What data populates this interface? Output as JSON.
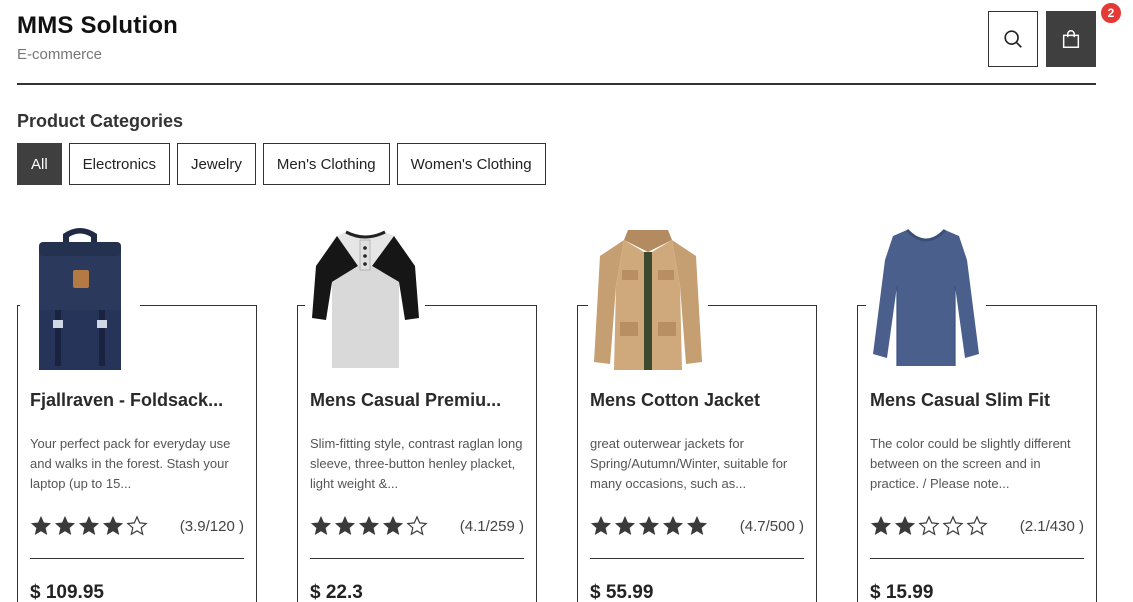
{
  "header": {
    "title": "MMS Solution",
    "subtitle": "E-commerce",
    "cart_count": "2"
  },
  "categories": {
    "heading": "Product Categories",
    "items": [
      "All",
      "Electronics",
      "Jewelry",
      "Men's Clothing",
      "Women's Clothing"
    ],
    "active": "All"
  },
  "products": [
    {
      "title": "Fjallraven - Foldsack...",
      "description": "Your perfect pack for everyday use and walks in the forest. Stash your laptop (up to 15...",
      "rating": 3.9,
      "rating_text": "(3.9/120 )",
      "price": "$ 109.95",
      "image": "backpack"
    },
    {
      "title": "Mens Casual Premiu...",
      "description": "Slim-fitting style, contrast raglan long sleeve, three-button henley placket, light weight &...",
      "rating": 4.1,
      "rating_text": "(4.1/259 )",
      "price": "$ 22.3",
      "image": "raglan-shirt"
    },
    {
      "title": "Mens Cotton Jacket",
      "description": "great outerwear jackets for Spring/Autumn/Winter, suitable for many occasions, such as...",
      "rating": 4.7,
      "rating_text": "(4.7/500 )",
      "price": "$ 55.99",
      "image": "jacket"
    },
    {
      "title": "Mens Casual Slim Fit",
      "description": "The color could be slightly different between on the screen and in practice. / Please note...",
      "rating": 2.1,
      "rating_text": "(2.1/430 )",
      "price": "$ 15.99",
      "image": "long-sleeve-tee"
    }
  ],
  "colors": {
    "dark": "#3f3f3f",
    "badge": "#e53935",
    "star_filled": "#3a3a3a",
    "star_empty": "#ffffff"
  }
}
